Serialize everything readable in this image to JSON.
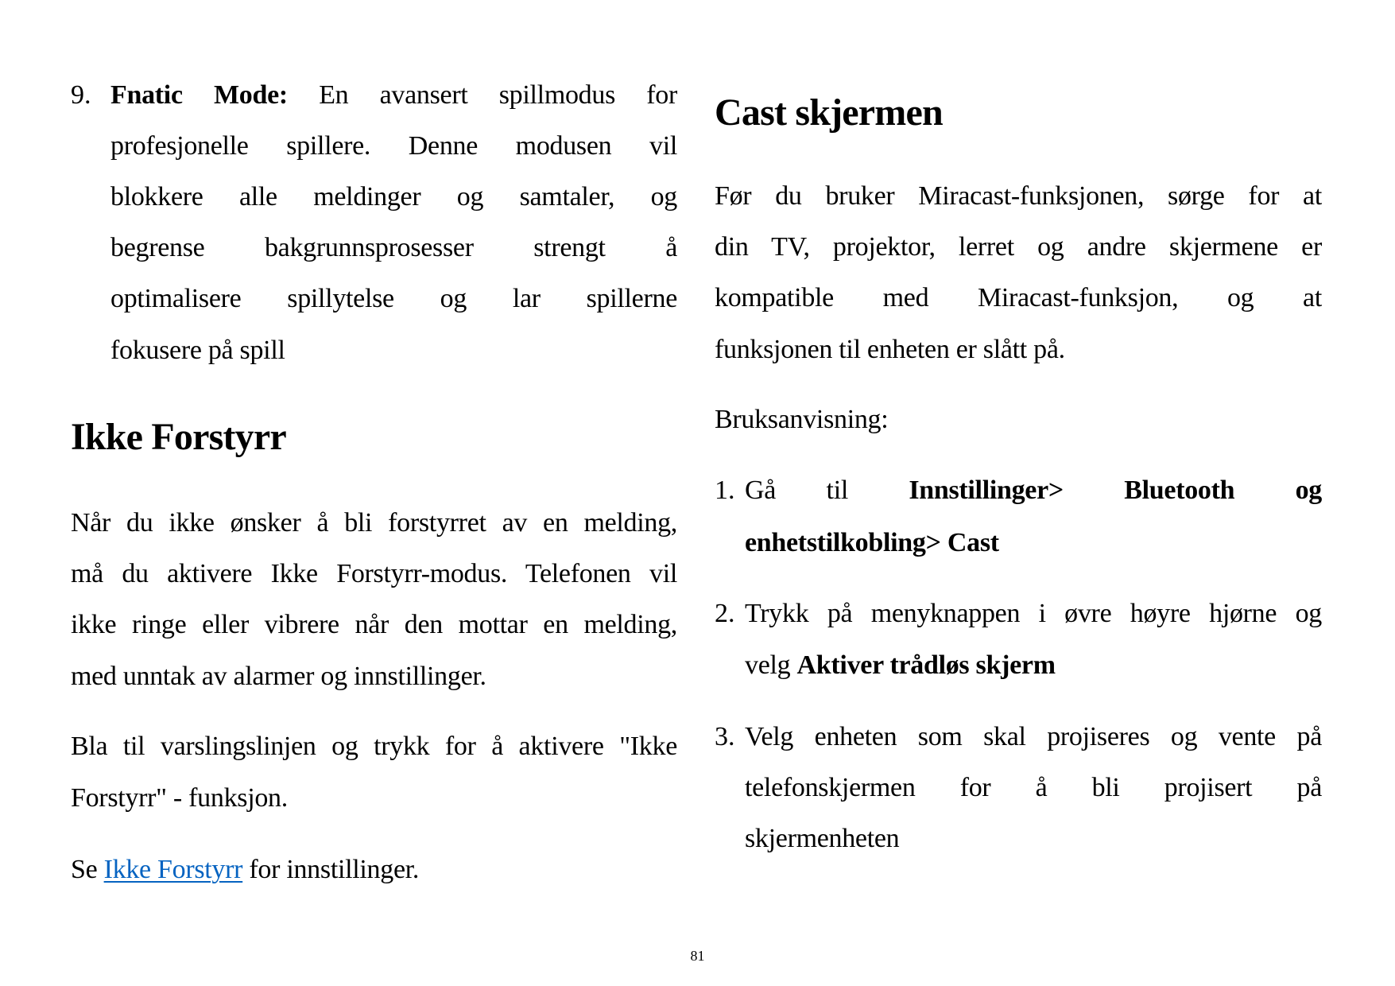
{
  "left_column": {
    "list_item_9": {
      "number": "9.",
      "bold_label": "Fnatic Mode:",
      "lines": [
        "En avansert spillmodus for",
        "profesjonelle spillere. Denne modusen vil",
        "blokkere alle meldinger og samtaler, og",
        "begrense bakgrunnsprosesser strengt å",
        "optimalisere spillytelse og lar spillerne",
        "fokusere på spill"
      ]
    },
    "section_dnd": {
      "heading": "Ikke Forstyrr",
      "paragraph_1": [
        "Når du ikke ønsker å bli forstyrret av en melding,",
        "må du aktivere Ikke Forstyrr-modus. Telefonen vil",
        "ikke ringe eller vibrere når den mottar en melding,",
        "med unntak av alarmer og innstillinger."
      ],
      "paragraph_2": [
        "Bla til varslingslinjen og trykk for å aktivere \"Ikke",
        "Forstyrr\" - funksjon."
      ],
      "paragraph_3": {
        "prefix": "Se",
        "link_text": "Ikke Forstyrr",
        "suffix": "for innstillinger."
      }
    }
  },
  "right_column": {
    "heading": "Cast skjermen",
    "intro": [
      "Før du bruker Miracast-funksjonen, sørge for at",
      "din TV, projektor, lerret og andre skjermene er",
      "kompatible med Miracast-funksjon, og at",
      "funksjonen til enheten er slått på."
    ],
    "instructions_label": "Bruksanvisning:",
    "steps": [
      {
        "number": "1.",
        "line1_plain": "Gå til",
        "line1_bold_a": "Innstillinger>",
        "line1_bold_b": "Bluetooth",
        "line1_bold_c": "og",
        "line2_bold": "enhetstilkobling> Cast"
      },
      {
        "number": "2.",
        "line1": "Trykk på menyknappen i øvre høyre hjørne og",
        "line2_plain": "velg",
        "line2_bold": "Aktiver trådløs skjerm"
      },
      {
        "number": "3.",
        "line1": "Velg enheten som skal projiseres og vente på",
        "line2": "telefonskjermen for å bli projisert på",
        "line3": "skjermenheten"
      }
    ]
  },
  "footer": {
    "page_number": "81"
  },
  "colors": {
    "text": "#000000",
    "link": "#0563C1",
    "background": "#FFFFFF"
  }
}
